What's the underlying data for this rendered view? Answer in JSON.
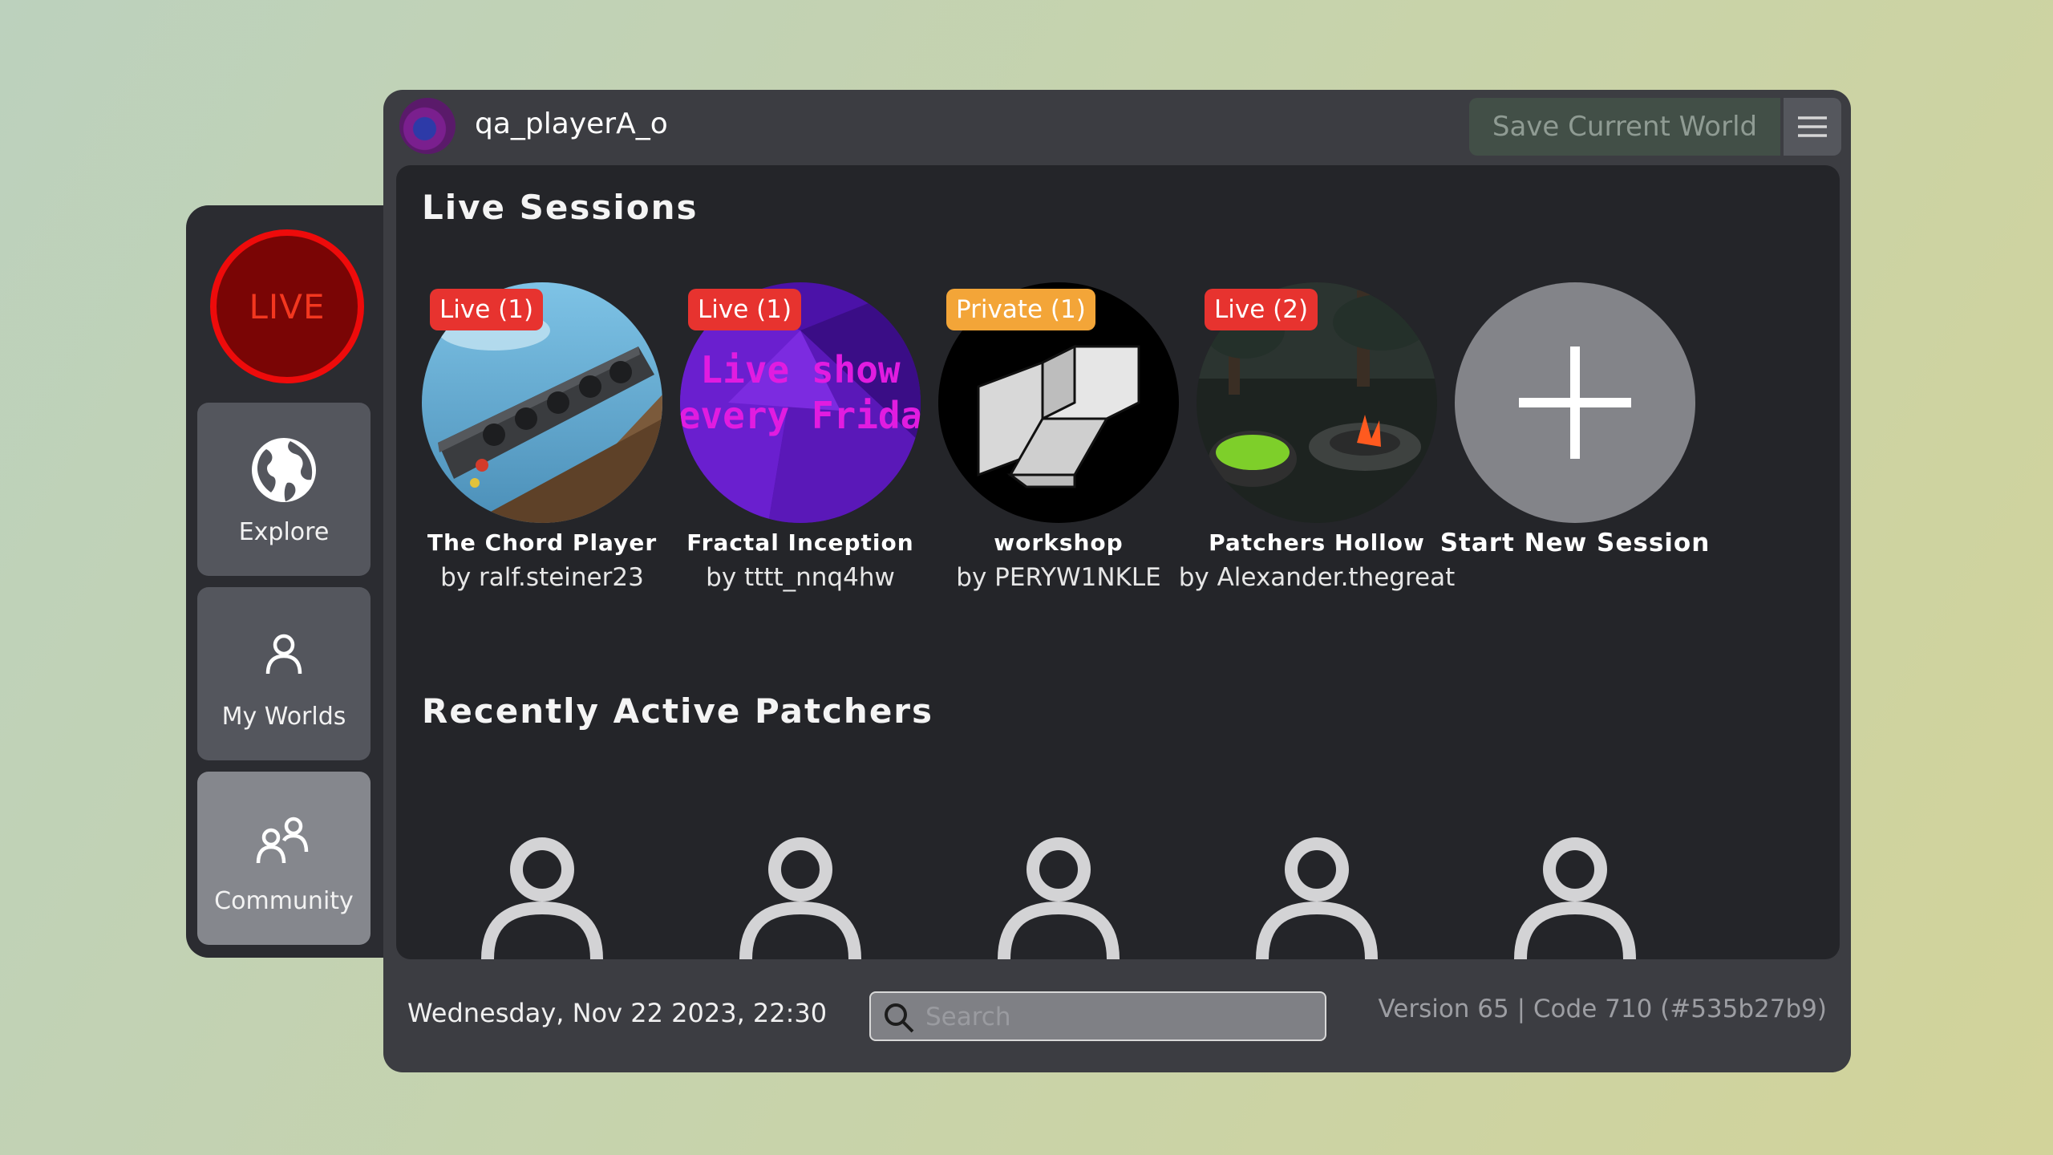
{
  "sidebar": {
    "live_label": "LIVE",
    "items": [
      {
        "label": "Explore",
        "icon": "globe-icon"
      },
      {
        "label": "My Worlds",
        "icon": "user-icon"
      },
      {
        "label": "Community",
        "icon": "users-icon"
      }
    ]
  },
  "header": {
    "username": "qa_playerA_o",
    "save_label": "Save Current World",
    "menu_icon": "hamburger-menu-icon"
  },
  "live_sessions": {
    "title": "Live Sessions",
    "sessions": [
      {
        "badge": "Live (1)",
        "title": "The Chord Player",
        "author": "by ralf.steiner23"
      },
      {
        "badge": "Live (1)",
        "title": "Fractal Inception",
        "author": "by tttt_nnq4hw",
        "thumb_text": "Live show every Friday"
      },
      {
        "badge": "Private (1)",
        "title": "workshop",
        "author": "by PERYW1NKLE"
      },
      {
        "badge": "Live (2)",
        "title": "Patchers Hollow",
        "author": "by Alexander.thegreat"
      }
    ],
    "new_session_label": "Start New Session"
  },
  "recent_patchers": {
    "title": "Recently Active Patchers"
  },
  "footer": {
    "datetime": "Wednesday, Nov 22 2023, 22:30",
    "search_placeholder": "Search",
    "version": "Version 65 | Code 710 (#535b27b9)"
  },
  "colors": {
    "live_badge": "#e7332f",
    "private_badge": "#f3a538",
    "live_ring": "#ee0b0b",
    "panel": "#242529"
  }
}
